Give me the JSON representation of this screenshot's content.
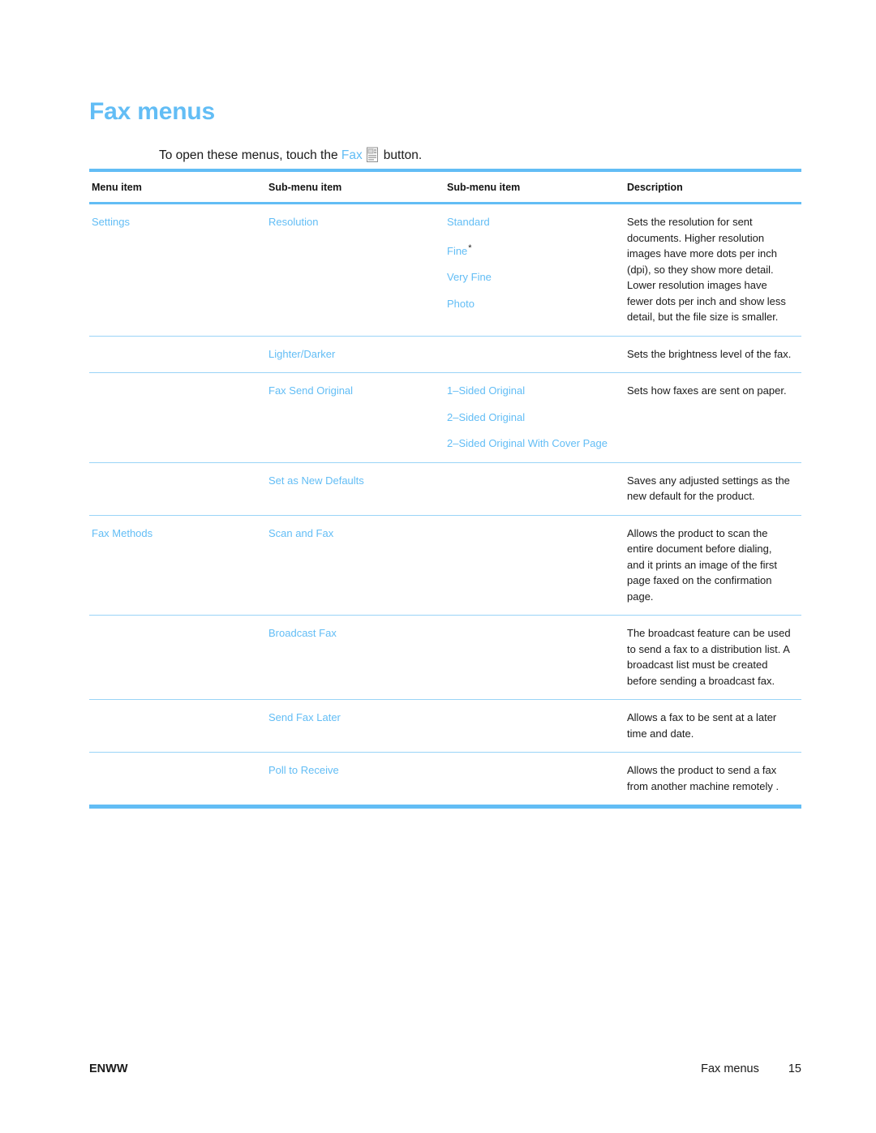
{
  "document": {
    "title": "Fax menus",
    "intro": {
      "before": "To open these menus, touch the",
      "blue_term": "Fax",
      "icon": "fax-button-icon",
      "after": "button."
    }
  },
  "table": {
    "headers": [
      "Menu item",
      "Sub-menu item",
      "Sub-menu item",
      "Description"
    ],
    "rows": [
      {
        "menu_item": "Settings",
        "sub_menu_1": "Resolution",
        "sub_menu_2": [
          "Standard",
          "Fine*",
          "Very Fine",
          "Photo"
        ],
        "description": "Sets the resolution for sent documents. Higher resolution images have more dots per inch (dpi), so they show more detail. Lower resolution images have fewer dots per inch and show less detail, but the file size is smaller."
      },
      {
        "menu_item": "",
        "sub_menu_1": "Lighter/Darker",
        "sub_menu_2": [],
        "description": "Sets the brightness level of the fax."
      },
      {
        "menu_item": "",
        "sub_menu_1": "Fax Send Original",
        "sub_menu_2": [
          "1–Sided Original",
          "2–Sided Original",
          "2–Sided Original With Cover Page"
        ],
        "description": "Sets how faxes are sent on paper."
      },
      {
        "menu_item": "",
        "sub_menu_1": "Set as New Defaults",
        "sub_menu_2": [],
        "description": "Saves any adjusted settings as the new default for the product."
      },
      {
        "menu_item": "Fax Methods",
        "sub_menu_1": "Scan and Fax",
        "sub_menu_2": [],
        "description": "Allows the product to scan the entire document before dialing, and it prints an image of the first page faxed on the confirmation page."
      },
      {
        "menu_item": "",
        "sub_menu_1": "Broadcast Fax",
        "sub_menu_2": [],
        "description": "The broadcast feature can be used to send a fax to a distribution list. A broadcast list must be created before sending a broadcast fax."
      },
      {
        "menu_item": "",
        "sub_menu_1": "Send Fax Later",
        "sub_menu_2": [],
        "description": "Allows a fax to be sent at a later time and date."
      },
      {
        "menu_item": "",
        "sub_menu_1": "Poll to Receive",
        "sub_menu_2": [],
        "description": "Allows the product to send a fax from another machine remotely ."
      }
    ]
  },
  "footer": {
    "left": "ENWW",
    "section": "Fax menus",
    "page_number": "15"
  },
  "colors": {
    "accent_blue": "#62bdf5",
    "rule_light": "#9ad4f7",
    "text": "#1a1a1a"
  }
}
